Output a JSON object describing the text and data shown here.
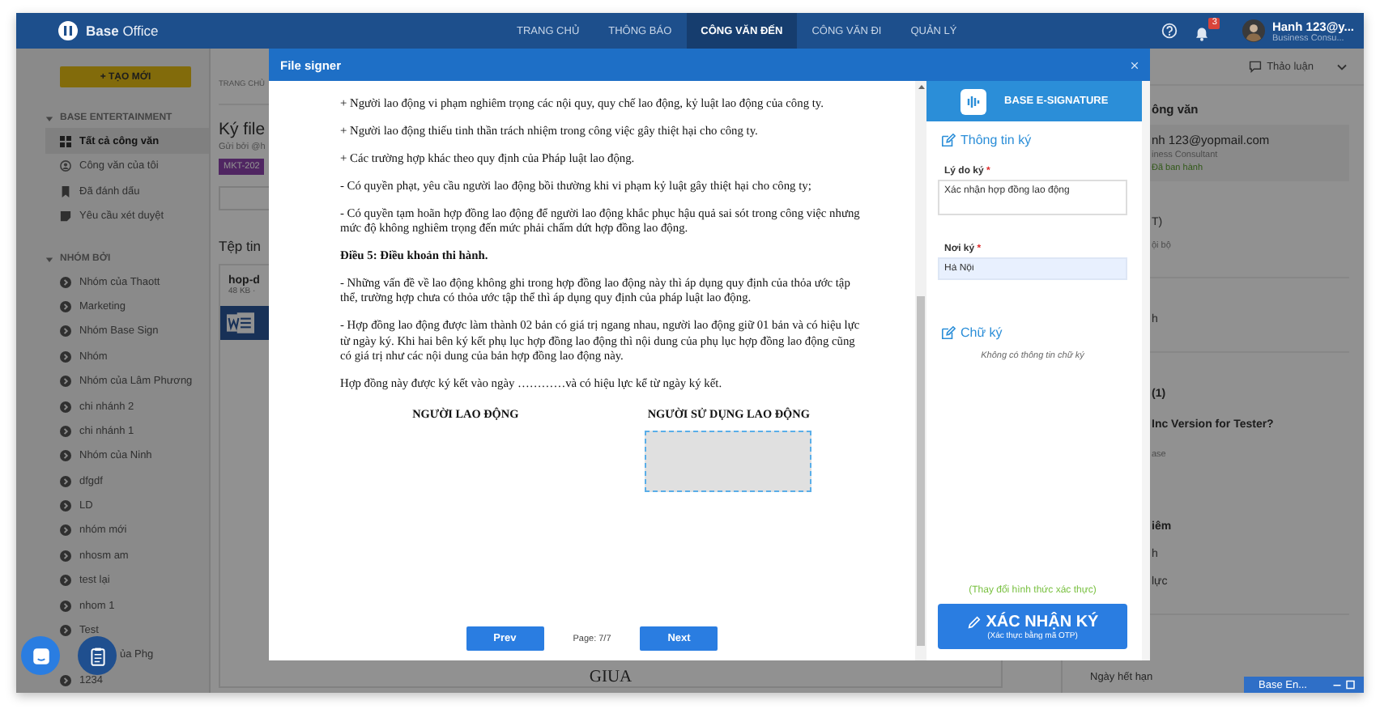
{
  "top_bar": {
    "logo": "**Base** Office",
    "nav": [
      {
        "label": "TRANG CHỦ",
        "selected": false
      },
      {
        "label": "THÔNG BÁO",
        "selected": false
      },
      {
        "label": "CÔNG VĂN ĐẾN",
        "selected": true
      },
      {
        "label": "CÔNG VĂN ĐI",
        "selected": false
      },
      {
        "label": "QUẢN LÝ",
        "selected": false
      }
    ],
    "notification_count": "3",
    "user": {
      "name": "Hanh 123@y...",
      "role": "Business Consu..."
    }
  },
  "sidebar": {
    "create_button": "+ TẠO MỚI",
    "sections": [
      {
        "title": "BASE ENTERTAINMENT",
        "expanded": true,
        "items": [
          {
            "label": "Tất cả công văn",
            "kind": "grid",
            "selected": true
          },
          {
            "label": "Công văn của tôi",
            "kind": "person",
            "selected": false
          },
          {
            "label": "Đã đánh dấu",
            "kind": "bookmark",
            "selected": false
          },
          {
            "label": "Yêu cầu xét duyệt",
            "kind": "note",
            "selected": false
          }
        ]
      },
      {
        "title": "NHÓM BỞI",
        "expanded": true,
        "items": [
          {
            "label": "Nhóm của Thaott",
            "kind": "group",
            "selected": false
          },
          {
            "label": "Marketing",
            "kind": "group",
            "selected": false
          },
          {
            "label": "Nhóm Base Sign",
            "kind": "group",
            "selected": false
          },
          {
            "label": "Nhóm",
            "kind": "group",
            "selected": false
          },
          {
            "label": "Nhóm của Lâm Phương",
            "kind": "group",
            "selected": false
          },
          {
            "label": "chi nhánh 2",
            "kind": "group",
            "selected": false
          },
          {
            "label": "chi nhánh 1",
            "kind": "group",
            "selected": false
          },
          {
            "label": "Nhóm của Ninh",
            "kind": "group",
            "selected": false
          },
          {
            "label": "dfgdf",
            "kind": "group",
            "selected": false
          },
          {
            "label": "LD",
            "kind": "group",
            "selected": false
          },
          {
            "label": "nhóm mới",
            "kind": "group",
            "selected": false
          },
          {
            "label": "nhosm am",
            "kind": "group",
            "selected": false
          },
          {
            "label": "test lại",
            "kind": "group",
            "selected": false
          },
          {
            "label": "nhom 1",
            "kind": "group",
            "selected": false
          },
          {
            "label": "Test",
            "kind": "group",
            "selected": false
          },
          {
            "label": "ủa Phg",
            "kind": "covered",
            "selected": false
          },
          {
            "label": "1234",
            "kind": "group",
            "selected": false
          }
        ]
      }
    ]
  },
  "content": {
    "breadcrumb": "TRANG CHỦ",
    "title": "Ký file",
    "sender": "Gửi bởi @h",
    "tag": "MKT-202",
    "files_heading": "Tệp tin",
    "file": {
      "name": "hop-d",
      "meta": "48 KB ·"
    },
    "preview_text": "GIUA"
  },
  "info_panel": {
    "discuss_button": "Thảo luận",
    "heading": "ông văn",
    "card": {
      "email": "nh 123@yopmail.com",
      "role": "iness Consultant",
      "status": "Đã ban hành"
    },
    "sections": [
      [
        {
          "text": "T)",
          "kind": "text"
        },
        {
          "text": "ội bộ",
          "kind": "muted"
        }
      ],
      [
        {
          "text": "h",
          "kind": "text"
        }
      ],
      [
        {
          "text": "(1)",
          "kind": "heading"
        },
        {
          "text": "Inc Version for Tester?",
          "kind": "heading"
        },
        {
          "text": "ase",
          "kind": "muted"
        }
      ],
      [
        {
          "text": "iêm",
          "kind": "heading"
        },
        {
          "text": "h",
          "kind": "text"
        },
        {
          "text": "lực",
          "kind": "text"
        }
      ]
    ],
    "footer_label": "Ngày hết hạn"
  },
  "chat_tab": {
    "label": "Base En..."
  },
  "modal": {
    "title": "File signer",
    "document": {
      "paragraphs": [
        {
          "text": "+ Người lao động vi phạm nghiêm trọng các nội quy, quy chế lao động, kỷ luật lao động của công ty.",
          "bold": false
        },
        {
          "text": "+ Người lao động thiếu tinh thần trách nhiệm trong công việc gây thiệt hại cho công ty.",
          "bold": false
        },
        {
          "text": "+ Các trường hợp khác theo quy định của Pháp luật lao động.",
          "bold": false
        },
        {
          "text": "- Có quyền phạt, yêu cầu người lao động bồi thường khi vi phạm kỷ luật gây thiệt hại cho công ty;",
          "bold": false
        },
        {
          "text": "- Có quyền tạm hoãn hợp đồng lao động để người lao động khắc phục hậu quả sai sót trong công việc nhưng mức độ không nghiêm trọng đến mức phải chấm dứt hợp đồng lao động.",
          "bold": false
        },
        {
          "text": "Điều 5: Điều khoản thi hành.",
          "bold": true
        },
        {
          "text": "- Những vấn đề về lao động không ghi trong hợp đồng lao động này thì áp dụng quy định của thỏa ước tập thể, trường hợp chưa có thỏa ước tập thể thì áp dụng quy định của pháp luật lao động.",
          "bold": false
        },
        {
          "text": "- Hợp đồng lao động được làm thành 02 bản có giá trị ngang nhau, người lao động giữ 01 bản và có hiệu lực từ ngày ký. Khi hai bên ký kết phụ lục hợp đồng lao động thì nội dung của phụ lục hợp đồng lao động cũng có giá trị như các nội dung của bản hợp đồng lao động này.",
          "bold": false
        },
        {
          "text": "Hợp đồng này được ký kết vào ngày …………và có hiệu lực kể từ ngày ký kết.",
          "bold": false
        }
      ],
      "signers": [
        {
          "title": "NGƯỜI LAO ĐỘNG",
          "signature_box": false
        },
        {
          "title": "NGƯỜI SỬ DỤNG LAO ĐỘNG",
          "signature_box": true
        }
      ],
      "prev_button": "Prev",
      "page": "Page: 7/7",
      "next_button": "Next"
    },
    "panel": {
      "brand": "BASE E-SIGNATURE",
      "info_heading": "Thông tin ký",
      "reason_label": "Lý do ký",
      "reason_required_mark": "*",
      "reason_value": "Xác nhận hợp đồng lao động",
      "place_label": "Nơi ký",
      "place_required_mark": "*",
      "place_value": "Hà Nội",
      "signature_heading": "Chữ ký",
      "signature_empty": "Không có thông tin chữ ký",
      "change_method_link": "(Thay đổi hình thức xác thực)",
      "confirm_button": "XÁC NHẬN KÝ",
      "confirm_sub": "(Xác thực bằng mã OTP)"
    }
  }
}
